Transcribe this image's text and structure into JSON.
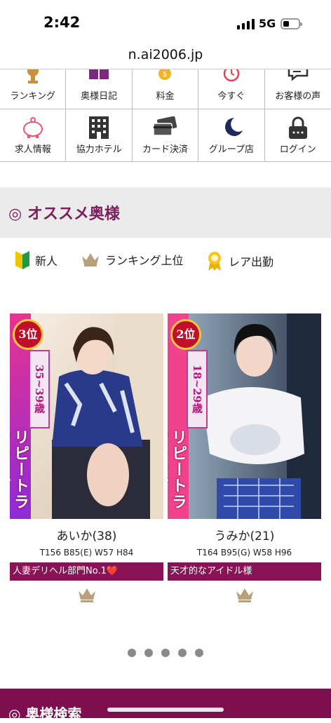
{
  "status_bar": {
    "time": "2:42",
    "network": "5G"
  },
  "url": "n.ai2006.jp",
  "menu": {
    "row1": [
      {
        "label": "ランキング",
        "icon": "trophy-icon"
      },
      {
        "label": "奥様日記",
        "icon": "book-icon"
      },
      {
        "label": "料金",
        "icon": "coins-icon"
      },
      {
        "label": "今すぐ",
        "icon": "alarm-clock-icon"
      },
      {
        "label": "お客様の声",
        "icon": "chat-bubble-icon"
      }
    ],
    "row2": [
      {
        "label": "求人情報",
        "icon": "piggy-bank-icon"
      },
      {
        "label": "協力ホテル",
        "icon": "building-icon"
      },
      {
        "label": "カード決済",
        "icon": "credit-card-icon"
      },
      {
        "label": "グループ店",
        "icon": "moon-icon"
      },
      {
        "label": "ログイン",
        "icon": "lock-icon"
      }
    ]
  },
  "recommend": {
    "title": "◎ オススメ奥様",
    "legend": [
      {
        "label": "新人",
        "icon": "beginner-mark-icon"
      },
      {
        "label": "ランキング上位",
        "icon": "crown-icon"
      },
      {
        "label": "レア出勤",
        "icon": "rosette-icon"
      }
    ]
  },
  "cards": [
    {
      "rank": "3位",
      "age_range": "35~39歳",
      "banner": "リピートランキング",
      "name": "あいか(38)",
      "size": "T156 B85(E) W57 H84",
      "catch": "人妻デリヘル部門No.1❤️",
      "colors": {
        "banner_top": "#e8338f",
        "banner_bottom": "#8e2bd6"
      }
    },
    {
      "rank": "2位",
      "age_range": "18~29歳",
      "banner": "リピートランキング",
      "name": "うみか(21)",
      "size": "T164 B95(G) W58 H96",
      "catch": "天才的なアイドル様",
      "colors": {
        "banner_top": "#f0438c",
        "banner_bottom": "#e8337f"
      }
    }
  ],
  "carousel": {
    "dots": 5
  },
  "search": {
    "title": "◎ 奥様検索"
  },
  "colors": {
    "accent": "#7a1f5c",
    "catch_bg": "#8a1358",
    "section_bg": "#ebebeb"
  }
}
